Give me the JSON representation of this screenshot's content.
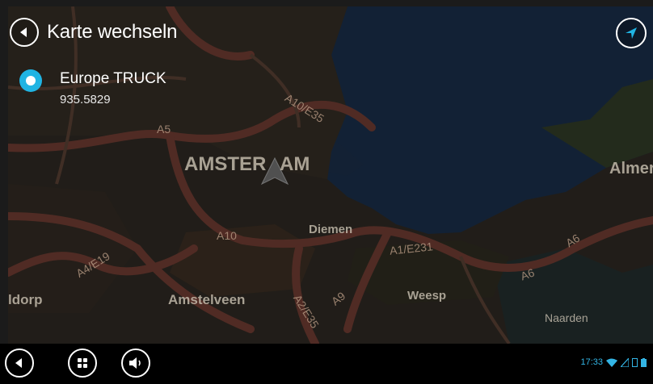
{
  "header": {
    "title": "Karte wechseln",
    "back_icon": "back-arrow-icon"
  },
  "nav_button": {
    "icon": "navigation-arrow-icon"
  },
  "map_option": {
    "name": "Europe TRUCK",
    "version": "935.5829",
    "selected": true
  },
  "map": {
    "places": [
      "AMSTER",
      "AM",
      "Almere",
      "Diemen",
      "Amstelveen",
      "Weesp",
      "Naarden",
      "ldorp"
    ],
    "roads": [
      "A10/E35",
      "A5",
      "A10",
      "A1/E231",
      "A6",
      "A6",
      "A4/E19",
      "A9",
      "A2/E35"
    ]
  },
  "system_bar": {
    "buttons": [
      "back-icon",
      "apps-grid-icon",
      "volume-icon"
    ],
    "time": "17:33"
  },
  "colors": {
    "accent": "#20b4e3",
    "status": "#33b5e5",
    "background": "#000000"
  }
}
